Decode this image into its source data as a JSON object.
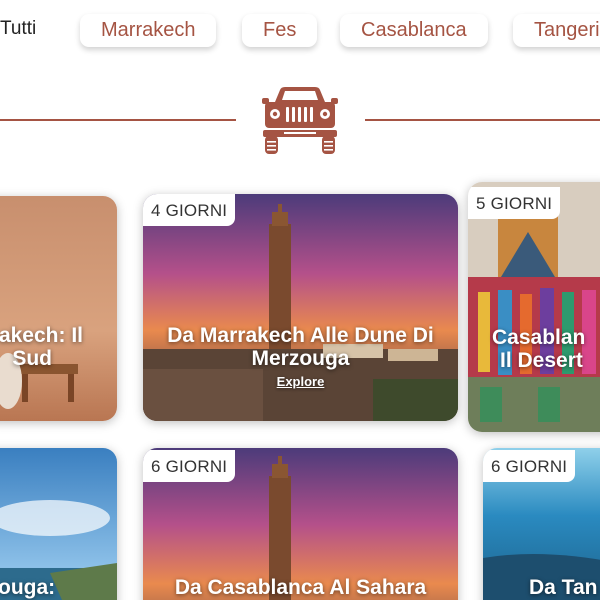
{
  "filters": {
    "all_label": "Tutti",
    "items": [
      {
        "label": "Marrakech"
      },
      {
        "label": "Fes"
      },
      {
        "label": "Casablanca"
      },
      {
        "label": "Tangeri"
      }
    ]
  },
  "colors": {
    "accent": "#a55443",
    "badge_bg": "#ffffff",
    "card_text": "#ffffff"
  },
  "divider": {
    "icon": "jeep-icon"
  },
  "cards": [
    {
      "badge": "",
      "title_lines": [
        "akech: Il",
        "Sud"
      ],
      "explore": ""
    },
    {
      "badge": "4 GIORNI",
      "title_lines": [
        "Da Marrakech Alle Dune Di",
        "Merzouga"
      ],
      "explore": "Explore"
    },
    {
      "badge": "5 GIORNI",
      "title_lines": [
        "Casablan",
        "Il Desert"
      ],
      "explore": ""
    },
    {
      "badge": "",
      "title_lines": [
        "ouga:"
      ],
      "explore": ""
    },
    {
      "badge": "6 GIORNI",
      "title_lines": [
        "Da Casablanca Al Sahara"
      ],
      "explore": ""
    },
    {
      "badge": "6 GIORNI",
      "title_lines": [
        "Da Tan"
      ],
      "explore": ""
    }
  ]
}
